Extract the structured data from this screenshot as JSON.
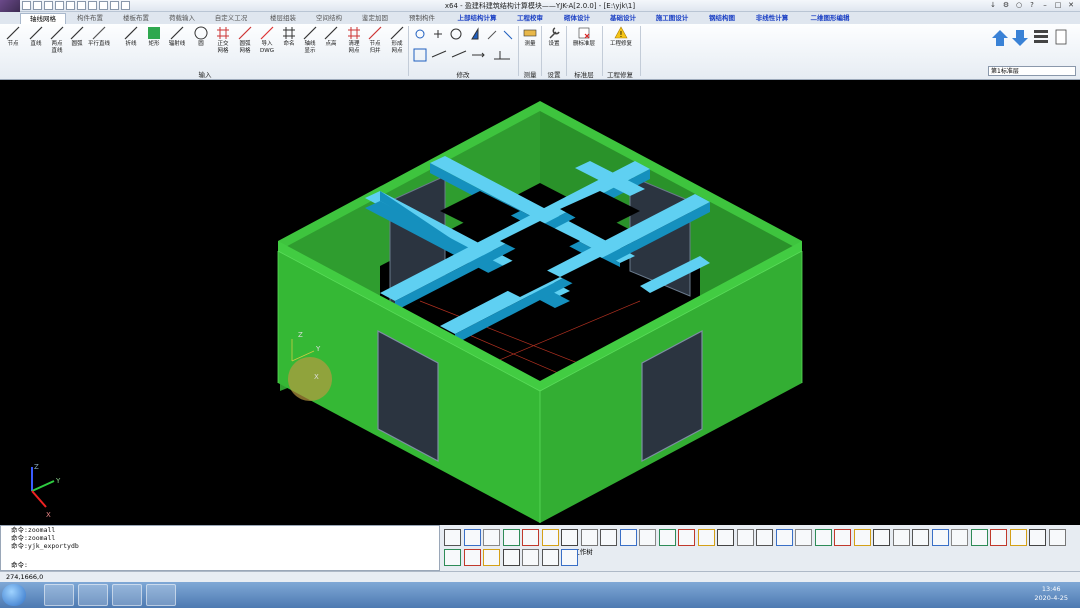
{
  "window": {
    "title": "x64 - 盈建科建筑结构计算模块——YJK-A[2.0.0] - [E:\\yjk\\1]"
  },
  "tabs": [
    {
      "label": "轴线网格",
      "active": true,
      "blue": false
    },
    {
      "label": "构件布置",
      "active": false,
      "blue": false
    },
    {
      "label": "楼板布置",
      "active": false,
      "blue": false
    },
    {
      "label": "荷载输入",
      "active": false,
      "blue": false
    },
    {
      "label": "自定义工况",
      "active": false,
      "blue": false
    },
    {
      "label": "楼层组装",
      "active": false,
      "blue": false
    },
    {
      "label": "空间结构",
      "active": false,
      "blue": false
    },
    {
      "label": "鉴定加固",
      "active": false,
      "blue": false
    },
    {
      "label": "预制构件",
      "active": false,
      "blue": false
    },
    {
      "label": "上部结构计算",
      "active": false,
      "blue": true
    },
    {
      "label": "工程校审",
      "active": false,
      "blue": true
    },
    {
      "label": "砌体设计",
      "active": false,
      "blue": true
    },
    {
      "label": "基础设计",
      "active": false,
      "blue": true
    },
    {
      "label": "施工图设计",
      "active": false,
      "blue": true
    },
    {
      "label": "钢结构图",
      "active": false,
      "blue": true
    },
    {
      "label": "非线性计算",
      "active": false,
      "blue": true
    },
    {
      "label": "二维图形编辑",
      "active": false,
      "blue": true
    }
  ],
  "ribbon": {
    "buttons": [
      {
        "l1": "节点",
        "l2": ""
      },
      {
        "l1": "直线",
        "l2": ""
      },
      {
        "l1": "两点",
        "l2": "直线"
      },
      {
        "l1": "圆弧",
        "l2": ""
      },
      {
        "l1": "平行直线",
        "l2": ""
      },
      {
        "l1": "折线",
        "l2": ""
      },
      {
        "l1": "矩形",
        "l2": ""
      },
      {
        "l1": "辐射线",
        "l2": ""
      },
      {
        "l1": "圆",
        "l2": ""
      },
      {
        "l1": "正交",
        "l2": "网格"
      },
      {
        "l1": "圆弧",
        "l2": "网格"
      },
      {
        "l1": "导入",
        "l2": "DWG"
      },
      {
        "l1": "命名",
        "l2": ""
      },
      {
        "l1": "轴线",
        "l2": "显示"
      },
      {
        "l1": "点高",
        "l2": ""
      },
      {
        "l1": "清理",
        "l2": "网点"
      },
      {
        "l1": "节点",
        "l2": "归并"
      },
      {
        "l1": "形成",
        "l2": "网点"
      }
    ],
    "right_buttons": [
      {
        "label": "测量"
      },
      {
        "label": "设置"
      },
      {
        "label": "删标准层"
      },
      {
        "label": "工程修复"
      }
    ],
    "groups": {
      "input": "输入",
      "modify": "修改",
      "measure": "测量",
      "settings": "设置",
      "standard_story": "标准层",
      "project_repair": "工程修复"
    },
    "story_select": "第1标准层"
  },
  "viewport": {
    "axis_x": "X",
    "axis_y": "Y",
    "axis_z": "Z",
    "colors": {
      "wall": "#34b534",
      "beam": "#1aa6d6",
      "background": "#000000"
    }
  },
  "command": {
    "lines": [
      "命令:zoomall",
      "命令:zoomall",
      "命令:yjk_exportydb"
    ],
    "prompt": "命令:"
  },
  "tools_row2": {
    "work_tree": "工作树"
  },
  "status": {
    "coords": "274,1666,0"
  },
  "taskbar": {
    "time": "13:46",
    "date": "2020-4-25"
  }
}
